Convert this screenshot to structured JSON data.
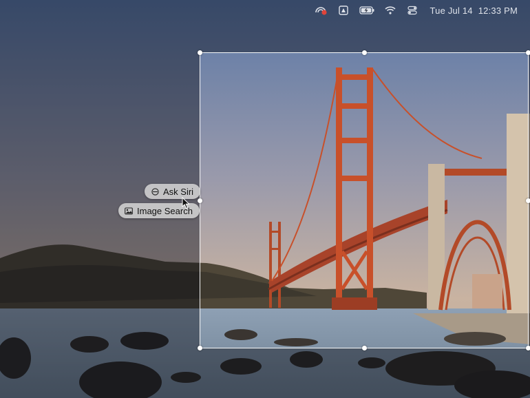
{
  "menubar": {
    "icons": [
      "screen-mirror-record-icon",
      "drive-icon",
      "battery-charging-icon",
      "wifi-icon",
      "control-center-icon"
    ],
    "date": "Tue Jul 14",
    "time": "12:33 PM"
  },
  "context_menu": {
    "ask_siri": {
      "label": "Ask Siri",
      "icon": "siri-icon"
    },
    "image_search": {
      "label": "Image Search",
      "icon": "image-search-icon"
    }
  },
  "colors": {
    "bridge": "#c8502a",
    "selection_border": "#ffffff",
    "menu_pill": "#d2d2d2"
  }
}
